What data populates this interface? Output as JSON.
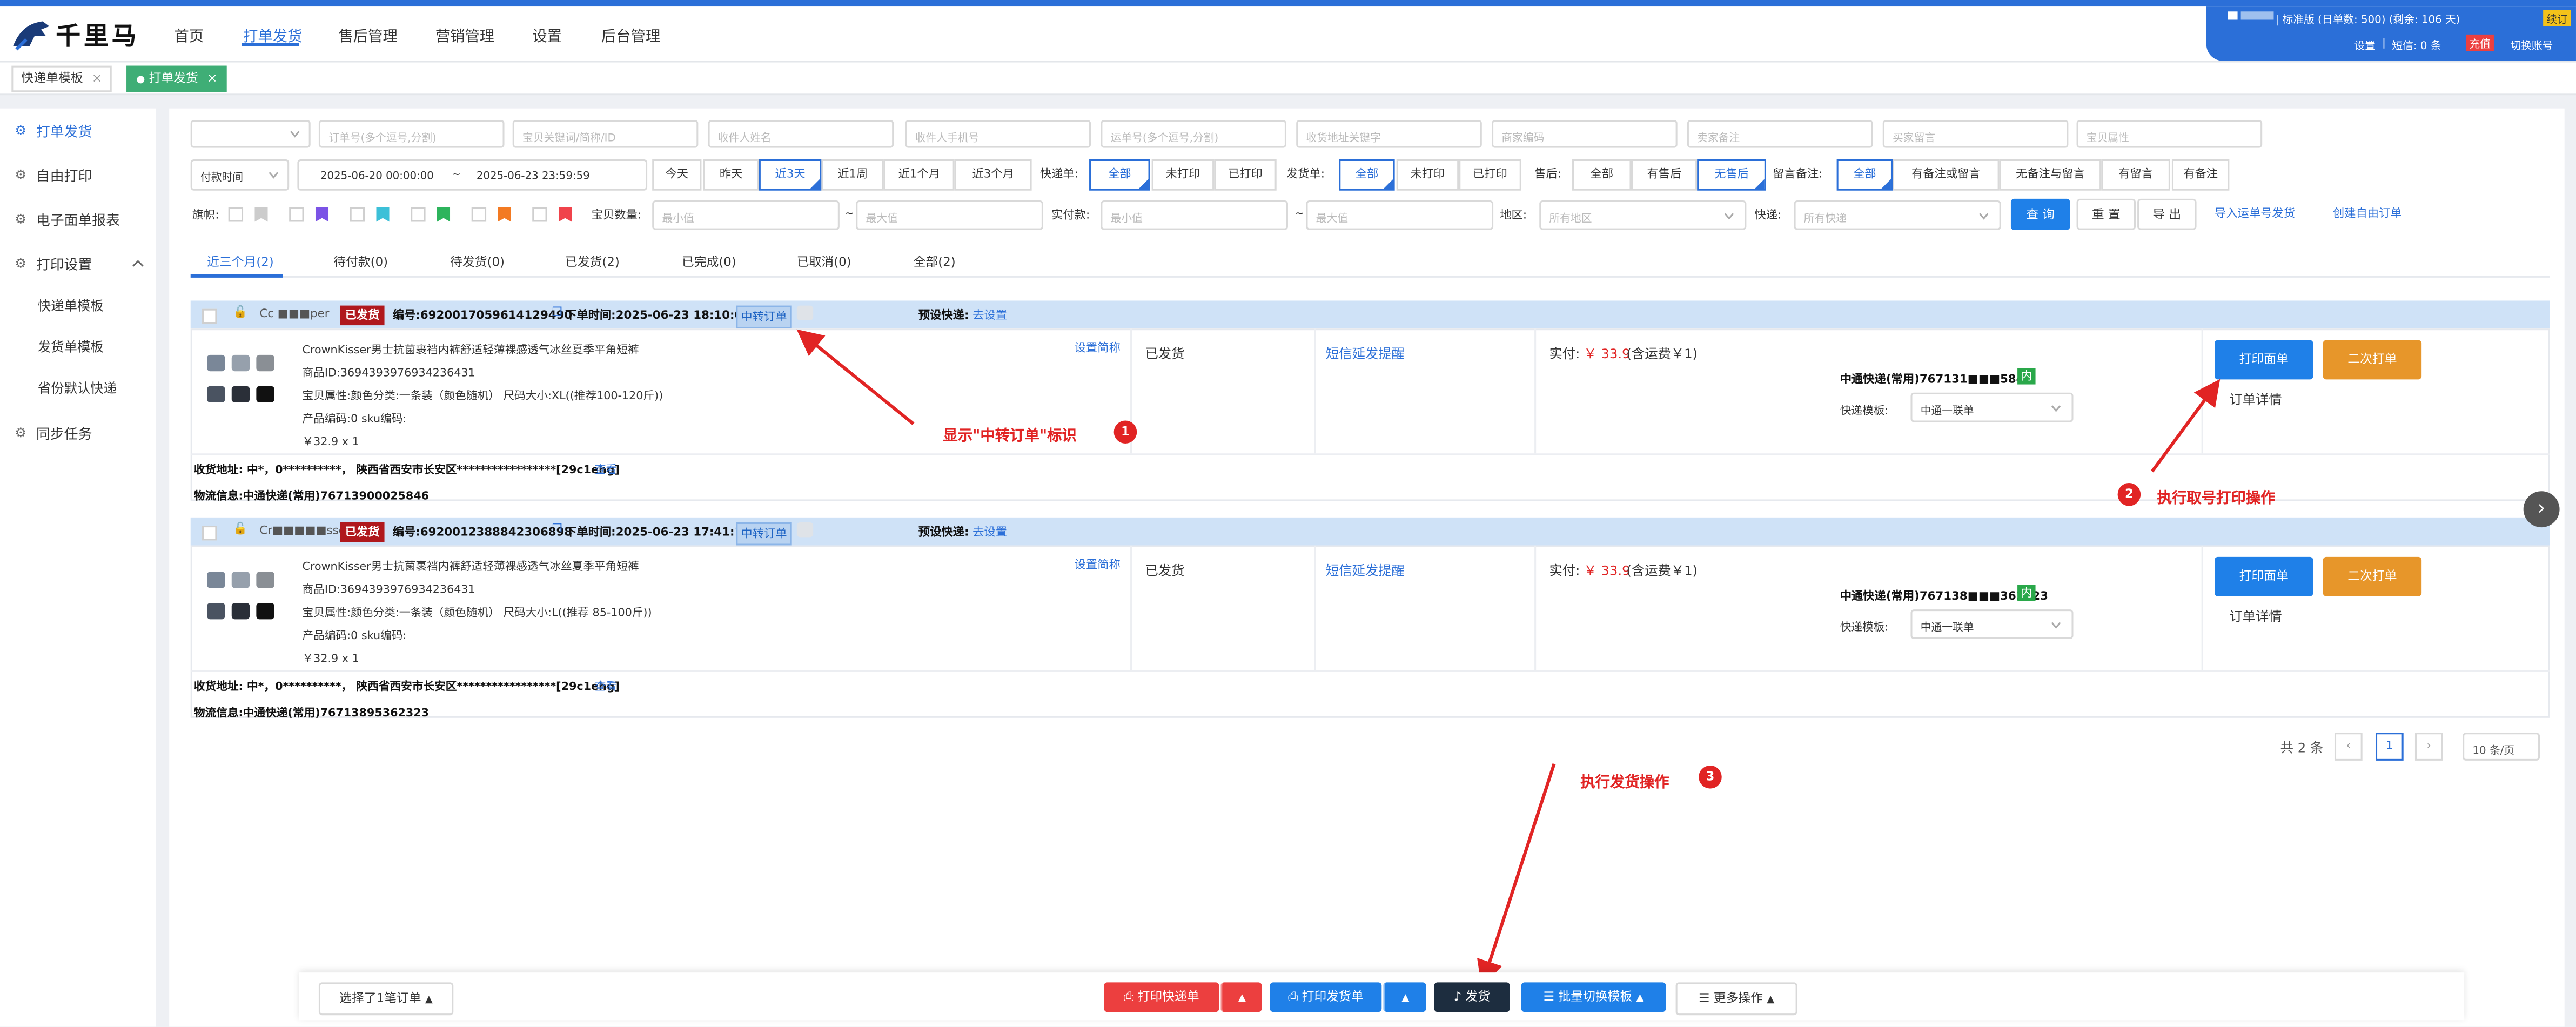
{
  "colors": {
    "primary": "#2b6fd8",
    "button_blue": "#1f80e8",
    "orange": "#e7962a",
    "danger": "#ec3f3f",
    "annotation_red": "#e12424",
    "shipped_badge": "#b0181d",
    "tab_green": "#3fae76",
    "order_header_bg": "#cfe2f7"
  },
  "header": {
    "logo_text": "千里马",
    "nav": [
      "首页",
      "打单发货",
      "售后管理",
      "营销管理",
      "设置",
      "后台管理"
    ],
    "nav_active": "打单发货",
    "account": {
      "line1": "| 标准版 (日单数: 500) (剩余: 106 天)",
      "badge": "续订",
      "line2_items": [
        "设置",
        "短信: 0 条"
      ],
      "recharge": "充值",
      "switch_account": "切换账号"
    }
  },
  "tabs": [
    {
      "label": "快递单模板",
      "close": "×"
    },
    {
      "label": "打单发货",
      "close": "×",
      "active": true
    }
  ],
  "sidebar": {
    "items": [
      {
        "icon": "gear-icon",
        "label": "打单发货",
        "active": true
      },
      {
        "icon": "gear-icon",
        "label": "自由打印"
      },
      {
        "icon": "gear-icon",
        "label": "电子面单报表"
      },
      {
        "icon": "gear-icon",
        "label": "打印设置",
        "expand": "chevron-up-icon"
      },
      {
        "icon": "gear-icon",
        "label": "同步任务"
      }
    ],
    "subitems": [
      "快递单模板",
      "发货单模板",
      "省份默认快递"
    ]
  },
  "filters": {
    "row1_placeholders": [
      "订单号(多个逗号,分割)",
      "宝贝关键词/简称/ID",
      "收件人姓名",
      "收件人手机号",
      "运单号(多个逗号,分割)",
      "收货地址关键字",
      "商家编码",
      "卖家备注",
      "买家留言",
      "宝贝属性"
    ],
    "time_type": "付款时间",
    "date_start": "2025-06-20 00:00:00",
    "date_sep": "~",
    "date_end": "2025-06-23 23:59:59",
    "quick_ranges": [
      "今天",
      "昨天",
      "近3天",
      "近1周",
      "近1个月",
      "近3个月"
    ],
    "quick_selected": "近3天",
    "groups": [
      {
        "label": "快递单:",
        "options": [
          "全部",
          "未打印",
          "已打印"
        ],
        "selected": "全部"
      },
      {
        "label": "发货单:",
        "options": [
          "全部",
          "未打印",
          "已打印"
        ],
        "selected": "全部"
      },
      {
        "label": "售后:",
        "options": [
          "全部",
          "有售后",
          "无售后"
        ],
        "selected": "无售后"
      },
      {
        "label": "留言备注:",
        "options": [
          "全部",
          "有备注或留言",
          "无备注与留言",
          "有留言",
          "有备注"
        ],
        "selected": "全部"
      }
    ],
    "flag_label": "旗帜:",
    "flag_colors": [
      "#cccccc",
      "#7b53e6",
      "#3cc0d8",
      "#2db45c",
      "#f37a22",
      "#f0434b"
    ],
    "qty_label": "宝贝数量:",
    "paid_label": "实付款:",
    "min_placeholder": "最小值",
    "max_placeholder": "最大值",
    "range_sep": "~",
    "region_label": "地区:",
    "region_placeholder": "所有地区",
    "express_label": "快递:",
    "express_placeholder": "所有快递",
    "query": "查 询",
    "reset": "重 置",
    "export": "导 出",
    "import_link": "导入运单号发货",
    "create_link": "创建自由订单"
  },
  "status_tabs": [
    "近三个月(2)",
    "待付款(0)",
    "待发货(0)",
    "已发货(2)",
    "已完成(0)",
    "已取消(0)",
    "全部(2)"
  ],
  "status_active": "近三个月(2)",
  "orders": [
    {
      "buyer": "Cc ■■■per",
      "status_badge": "已发货",
      "order_no": "编号:6920017059614129490",
      "order_time": "下单时间:2025-06-23 18:10:03",
      "transfer_tag": "中转订单",
      "preset_label": "预设快递:",
      "preset_link": "去设置",
      "product": "CrownKisser男士抗菌裹裆内裤舒适轻薄裸感透气冰丝夏季平角短裤",
      "product_id": "商品ID:3694393976934236431",
      "attrs": "宝贝属性:颜色分类:一条装（颜色随机） 尺码大小:XL((推荐100-120斤))",
      "code": "产品编码:0   sku编码:",
      "price_qty": "￥32.9 x 1",
      "set_short": "设置简称",
      "ship_status": "已发货",
      "sms": "短信延发提醒",
      "paid_label": "实付:",
      "paid_amount": "￥ 33.9",
      "paid_note": "(含运费￥1)",
      "waybill": "中通快递(常用)767131■■■5846",
      "inner_tag": "内",
      "template_label": "快递模板:",
      "template_value": "中通一联单",
      "print_btn": "打印面单",
      "reprint_btn": "二次打单",
      "detail": "订单详情",
      "address": "收货地址: 中*，0**********， 陕西省西安市长安区*****************[29c1ehg]",
      "view": "查看",
      "logistics": "物流信息:中通快递(常用)76713900025846"
    },
    {
      "buyer": "Cr■■■■■sser",
      "status_badge": "已发货",
      "order_no": "编号:6920012388842306898",
      "order_time": "下单时间:2025-06-23 17:41:14",
      "transfer_tag": "中转订单",
      "preset_label": "预设快递:",
      "preset_link": "去设置",
      "product": "CrownKisser男士抗菌裹裆内裤舒适轻薄裸感透气冰丝夏季平角短裤",
      "product_id": "商品ID:3694393976934236431",
      "attrs": "宝贝属性:颜色分类:一条装（颜色随机） 尺码大小:L((推荐 85-100斤))",
      "code": "产品编码:0   sku编码:",
      "price_qty": "￥32.9 x 1",
      "set_short": "设置简称",
      "ship_status": "已发货",
      "sms": "短信延发提醒",
      "paid_label": "实付:",
      "paid_amount": "￥ 33.9",
      "paid_note": "(含运费￥1)",
      "waybill": "中通快递(常用)767138■■■362323",
      "inner_tag": "内",
      "template_label": "快递模板:",
      "template_value": "中通一联单",
      "print_btn": "打印面单",
      "reprint_btn": "二次打单",
      "detail": "订单详情",
      "address": "收货地址: 中*，0**********， 陕西省西安市长安区*****************[29c1ehg]",
      "view": "查看",
      "logistics": "物流信息:中通快递(常用)76713895362323"
    }
  ],
  "pagination": {
    "total": "共 2 条",
    "current": "1",
    "page_size": "10 条/页"
  },
  "annotations": [
    {
      "text": "显示\"中转订单\"标识",
      "num": "1"
    },
    {
      "text": "执行取号打印操作",
      "num": "2"
    },
    {
      "text": "执行发货操作",
      "num": "3"
    }
  ],
  "bottom_bar": {
    "selected": "选择了1笔订单",
    "print_express": "打印快递单",
    "print_invoice": "打印发货单",
    "ship": "发货",
    "batch_switch": "批量切换模板",
    "more": "更多操作"
  }
}
